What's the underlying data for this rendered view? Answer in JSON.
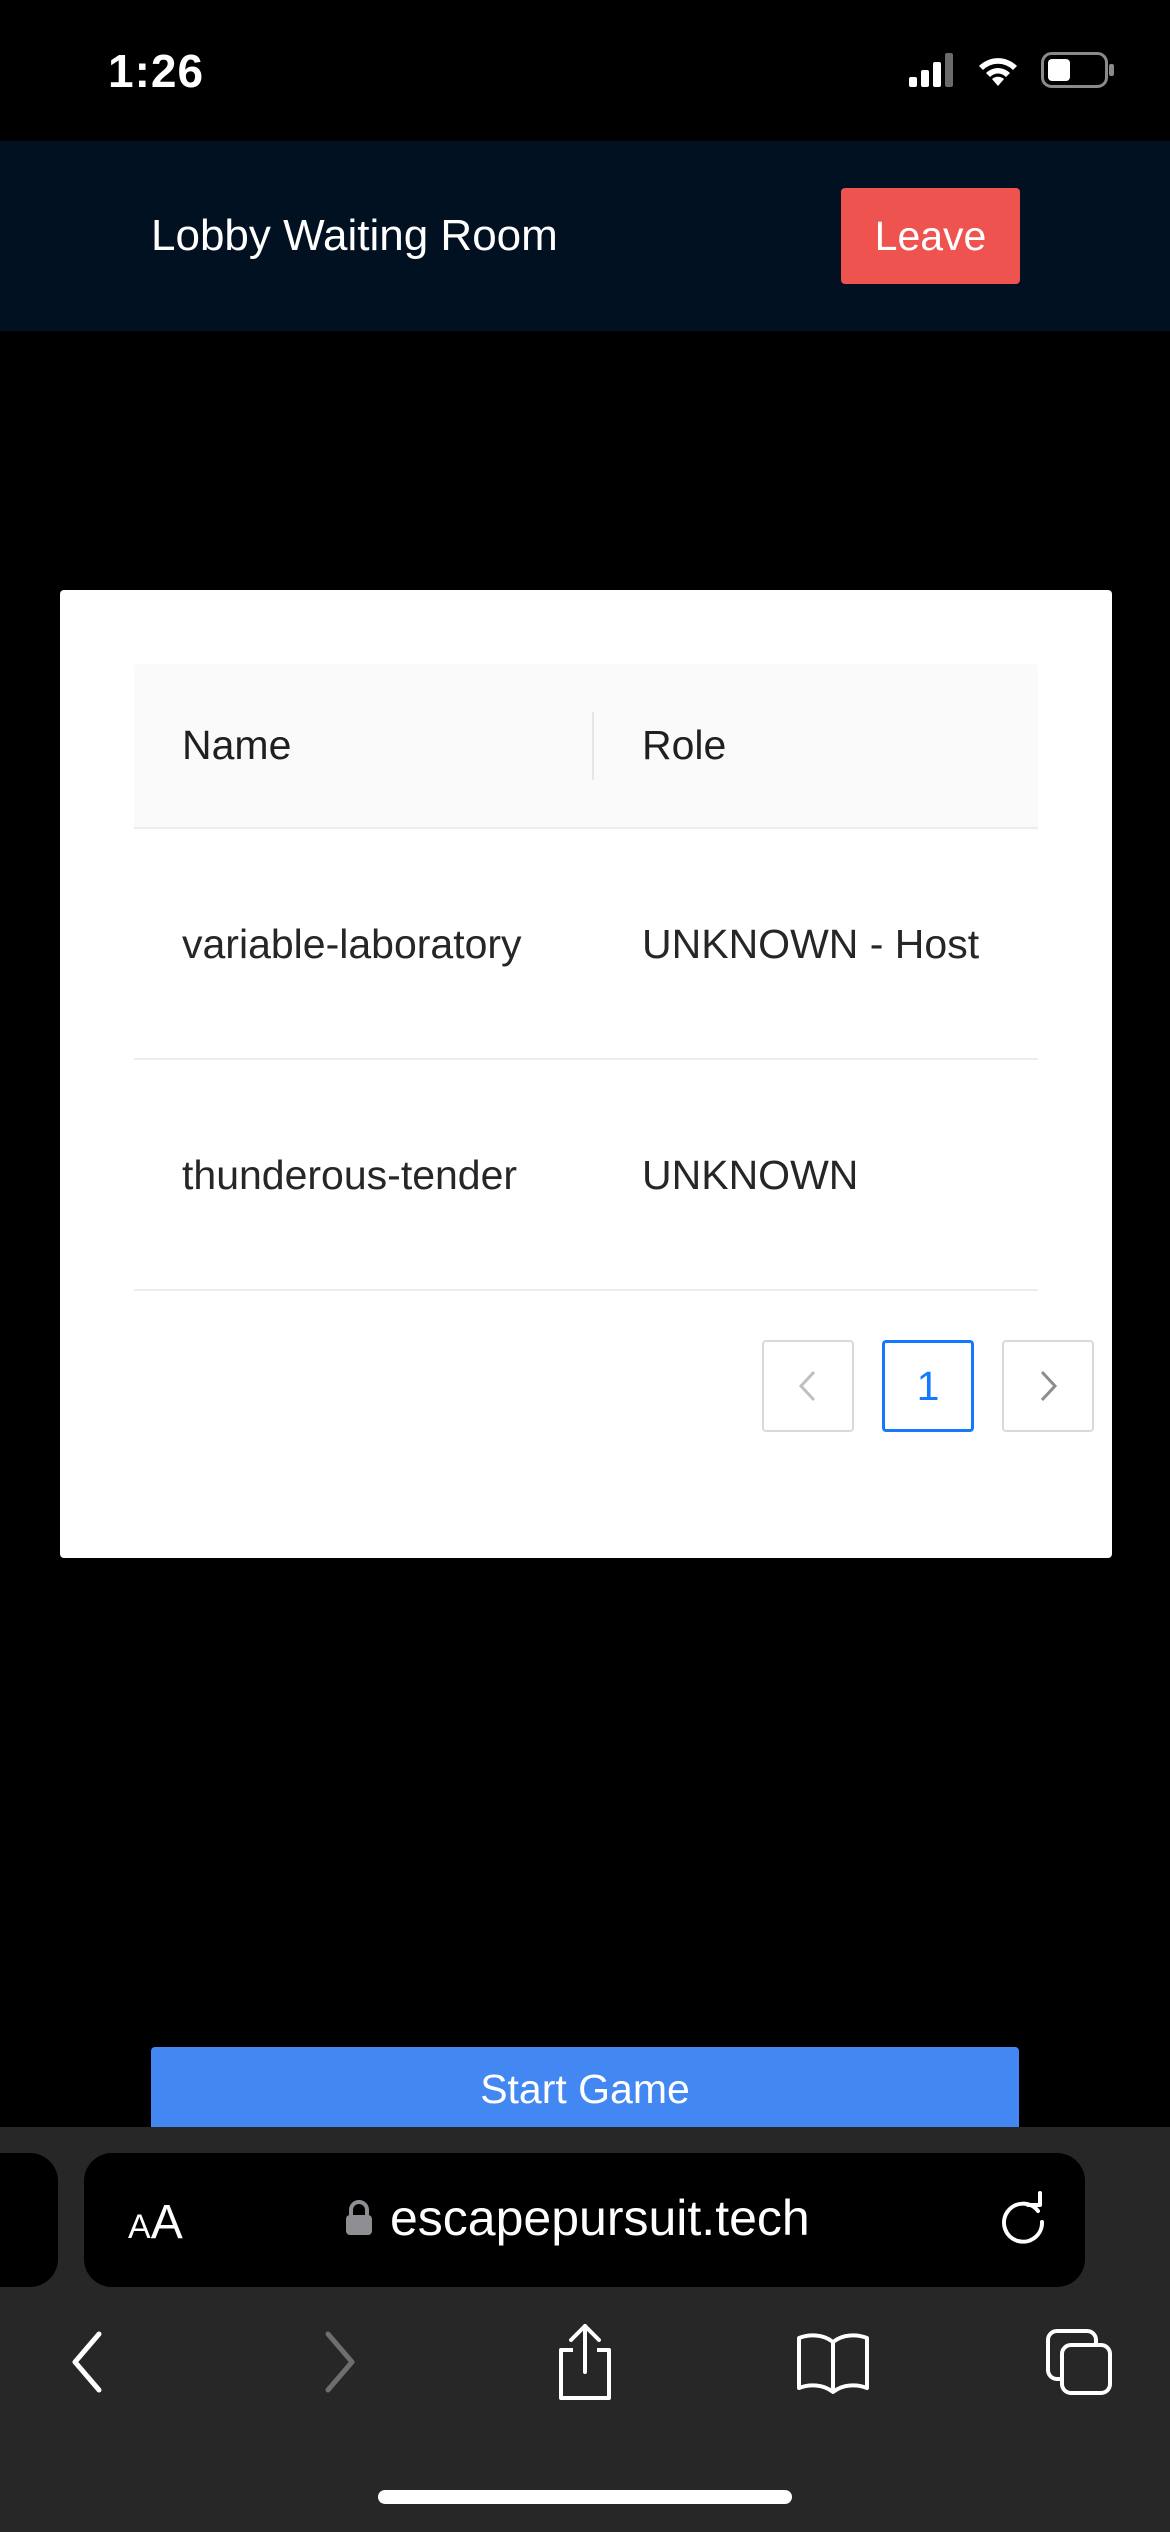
{
  "status_bar": {
    "time": "1:26",
    "icons": [
      "signal-icon",
      "wifi-icon",
      "battery-icon"
    ]
  },
  "header": {
    "title": "Lobby Waiting Room",
    "leave_label": "Leave"
  },
  "table": {
    "columns": [
      "Name",
      "Role"
    ],
    "rows": [
      {
        "name": "variable-laboratory",
        "role": "UNKNOWN - Host"
      },
      {
        "name": "thunderous-tender",
        "role": "UNKNOWN"
      }
    ]
  },
  "pagination": {
    "current_page": "1",
    "prev_icon": "chevron-left-icon",
    "next_icon": "chevron-right-icon"
  },
  "actions": {
    "start_label": "Start Game"
  },
  "browser": {
    "text_size_label": "AA",
    "url": "escapepursuit.tech",
    "toolbar_icons": [
      "back-icon",
      "forward-icon",
      "share-icon",
      "bookmarks-icon",
      "tabs-icon"
    ]
  },
  "colors": {
    "header_bg": "#021121",
    "leave_button": "#ef5350",
    "start_button": "#4388f2",
    "pagination_accent": "#1677ff"
  }
}
